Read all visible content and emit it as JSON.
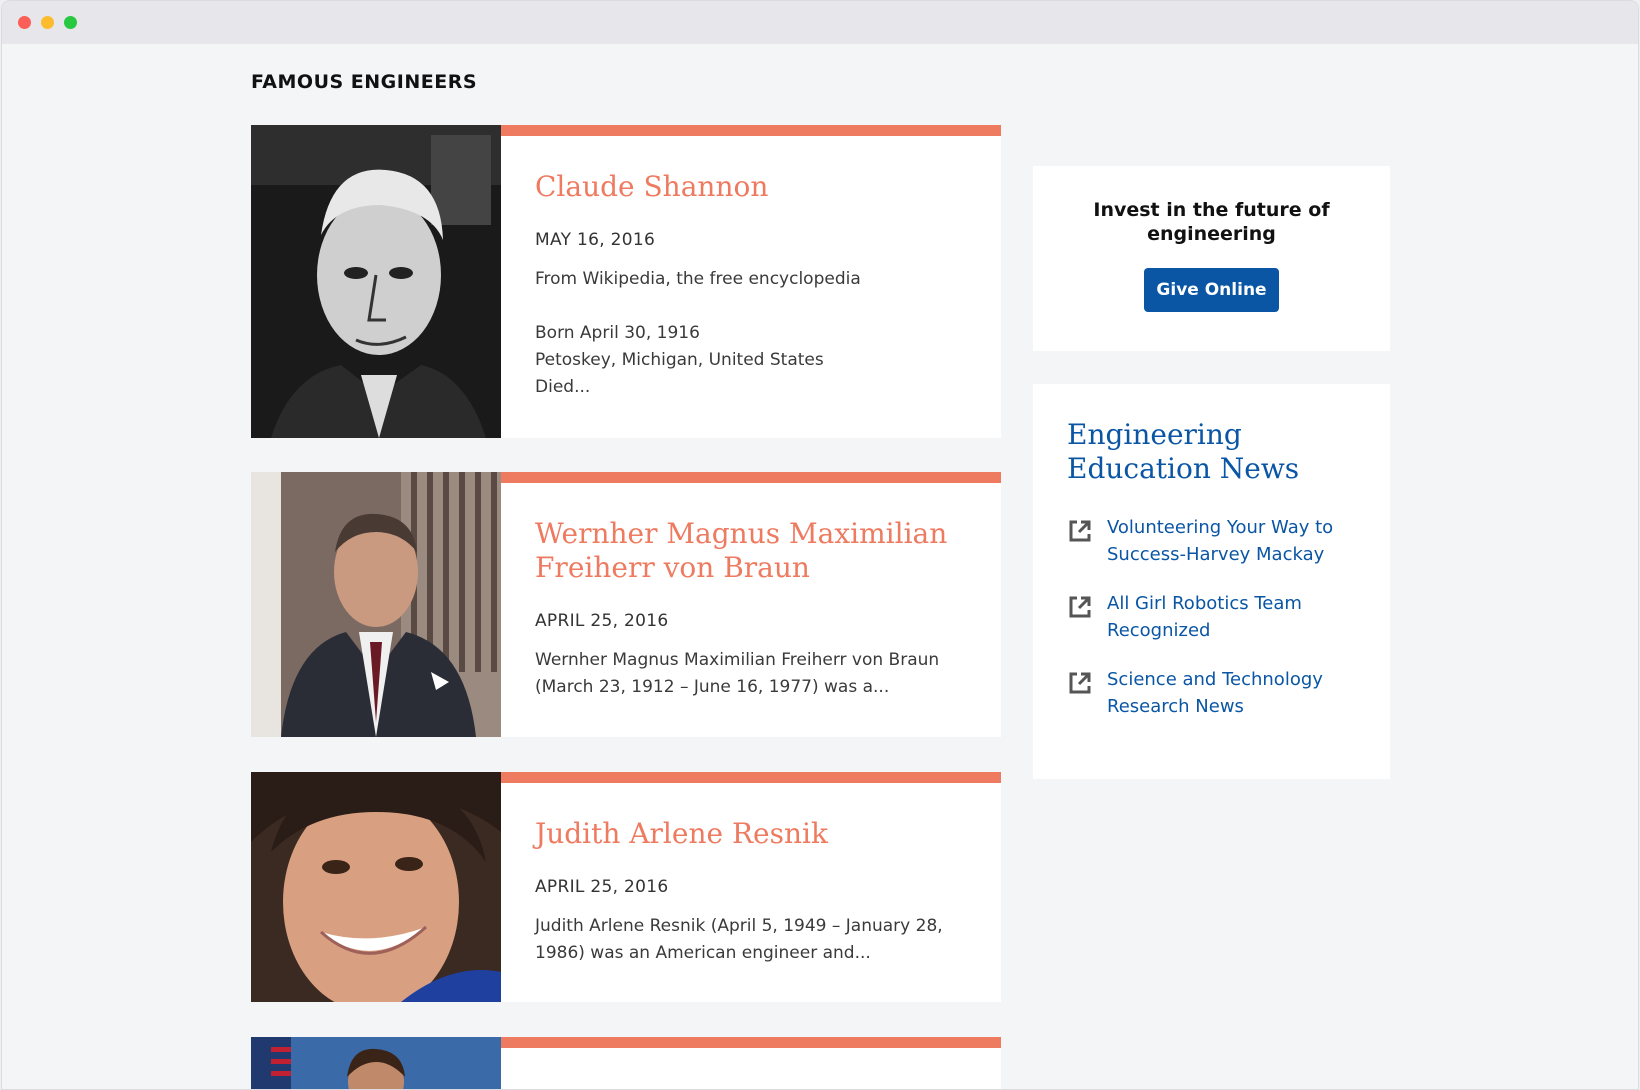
{
  "page": {
    "title": "FAMOUS ENGINEERS"
  },
  "articles": [
    {
      "name": "Claude Shannon",
      "date": "MAY 16, 2016",
      "excerpt": "From Wikipedia, the free encyclopedia\n\nBorn April 30, 1916\nPetoskey, Michigan, United States\nDied..."
    },
    {
      "name": "Wernher Magnus Maximilian Freiherr von Braun",
      "date": "APRIL 25, 2016",
      "excerpt": "Wernher Magnus Maximilian Freiherr von Braun (March 23, 1912 – June 16, 1977) was a..."
    },
    {
      "name": "Judith Arlene Resnik",
      "date": "APRIL 25, 2016",
      "excerpt": "Judith Arlene Resnik (April 5, 1949 – January 28, 1986) was an American engineer and..."
    }
  ],
  "donate": {
    "heading": "Invest in the future of engineering",
    "button_label": "Give Online"
  },
  "news": {
    "heading": "Engineering Education News",
    "items": [
      {
        "label": "Volunteering Your Way to Success-Harvey Mackay"
      },
      {
        "label": "All Girl Robotics Team Recognized"
      },
      {
        "label": "Science and Technology Research News"
      }
    ]
  },
  "colors": {
    "accent": "#ee7a5f",
    "link": "#0a56a5",
    "button": "#0a56a5"
  }
}
